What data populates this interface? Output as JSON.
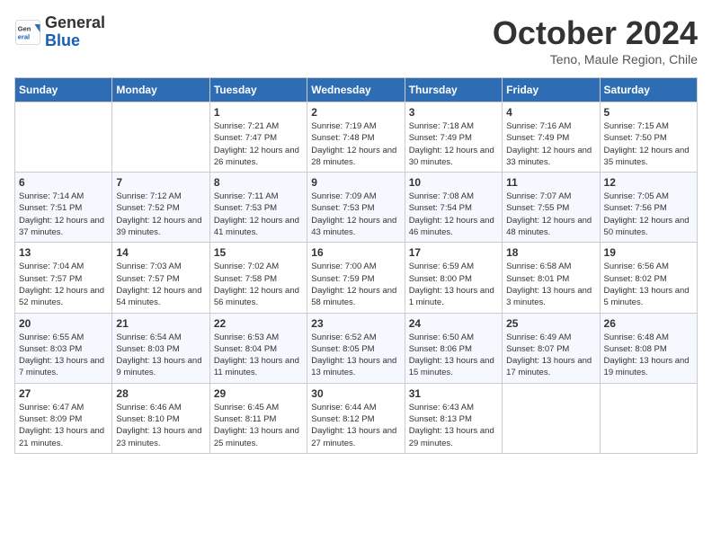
{
  "header": {
    "logo_general": "General",
    "logo_blue": "Blue",
    "month_title": "October 2024",
    "location": "Teno, Maule Region, Chile"
  },
  "days_of_week": [
    "Sunday",
    "Monday",
    "Tuesday",
    "Wednesday",
    "Thursday",
    "Friday",
    "Saturday"
  ],
  "weeks": [
    [
      {
        "day": "",
        "info": ""
      },
      {
        "day": "",
        "info": ""
      },
      {
        "day": "1",
        "info": "Sunrise: 7:21 AM\nSunset: 7:47 PM\nDaylight: 12 hours and 26 minutes."
      },
      {
        "day": "2",
        "info": "Sunrise: 7:19 AM\nSunset: 7:48 PM\nDaylight: 12 hours and 28 minutes."
      },
      {
        "day": "3",
        "info": "Sunrise: 7:18 AM\nSunset: 7:49 PM\nDaylight: 12 hours and 30 minutes."
      },
      {
        "day": "4",
        "info": "Sunrise: 7:16 AM\nSunset: 7:49 PM\nDaylight: 12 hours and 33 minutes."
      },
      {
        "day": "5",
        "info": "Sunrise: 7:15 AM\nSunset: 7:50 PM\nDaylight: 12 hours and 35 minutes."
      }
    ],
    [
      {
        "day": "6",
        "info": "Sunrise: 7:14 AM\nSunset: 7:51 PM\nDaylight: 12 hours and 37 minutes."
      },
      {
        "day": "7",
        "info": "Sunrise: 7:12 AM\nSunset: 7:52 PM\nDaylight: 12 hours and 39 minutes."
      },
      {
        "day": "8",
        "info": "Sunrise: 7:11 AM\nSunset: 7:53 PM\nDaylight: 12 hours and 41 minutes."
      },
      {
        "day": "9",
        "info": "Sunrise: 7:09 AM\nSunset: 7:53 PM\nDaylight: 12 hours and 43 minutes."
      },
      {
        "day": "10",
        "info": "Sunrise: 7:08 AM\nSunset: 7:54 PM\nDaylight: 12 hours and 46 minutes."
      },
      {
        "day": "11",
        "info": "Sunrise: 7:07 AM\nSunset: 7:55 PM\nDaylight: 12 hours and 48 minutes."
      },
      {
        "day": "12",
        "info": "Sunrise: 7:05 AM\nSunset: 7:56 PM\nDaylight: 12 hours and 50 minutes."
      }
    ],
    [
      {
        "day": "13",
        "info": "Sunrise: 7:04 AM\nSunset: 7:57 PM\nDaylight: 12 hours and 52 minutes."
      },
      {
        "day": "14",
        "info": "Sunrise: 7:03 AM\nSunset: 7:57 PM\nDaylight: 12 hours and 54 minutes."
      },
      {
        "day": "15",
        "info": "Sunrise: 7:02 AM\nSunset: 7:58 PM\nDaylight: 12 hours and 56 minutes."
      },
      {
        "day": "16",
        "info": "Sunrise: 7:00 AM\nSunset: 7:59 PM\nDaylight: 12 hours and 58 minutes."
      },
      {
        "day": "17",
        "info": "Sunrise: 6:59 AM\nSunset: 8:00 PM\nDaylight: 13 hours and 1 minute."
      },
      {
        "day": "18",
        "info": "Sunrise: 6:58 AM\nSunset: 8:01 PM\nDaylight: 13 hours and 3 minutes."
      },
      {
        "day": "19",
        "info": "Sunrise: 6:56 AM\nSunset: 8:02 PM\nDaylight: 13 hours and 5 minutes."
      }
    ],
    [
      {
        "day": "20",
        "info": "Sunrise: 6:55 AM\nSunset: 8:03 PM\nDaylight: 13 hours and 7 minutes."
      },
      {
        "day": "21",
        "info": "Sunrise: 6:54 AM\nSunset: 8:03 PM\nDaylight: 13 hours and 9 minutes."
      },
      {
        "day": "22",
        "info": "Sunrise: 6:53 AM\nSunset: 8:04 PM\nDaylight: 13 hours and 11 minutes."
      },
      {
        "day": "23",
        "info": "Sunrise: 6:52 AM\nSunset: 8:05 PM\nDaylight: 13 hours and 13 minutes."
      },
      {
        "day": "24",
        "info": "Sunrise: 6:50 AM\nSunset: 8:06 PM\nDaylight: 13 hours and 15 minutes."
      },
      {
        "day": "25",
        "info": "Sunrise: 6:49 AM\nSunset: 8:07 PM\nDaylight: 13 hours and 17 minutes."
      },
      {
        "day": "26",
        "info": "Sunrise: 6:48 AM\nSunset: 8:08 PM\nDaylight: 13 hours and 19 minutes."
      }
    ],
    [
      {
        "day": "27",
        "info": "Sunrise: 6:47 AM\nSunset: 8:09 PM\nDaylight: 13 hours and 21 minutes."
      },
      {
        "day": "28",
        "info": "Sunrise: 6:46 AM\nSunset: 8:10 PM\nDaylight: 13 hours and 23 minutes."
      },
      {
        "day": "29",
        "info": "Sunrise: 6:45 AM\nSunset: 8:11 PM\nDaylight: 13 hours and 25 minutes."
      },
      {
        "day": "30",
        "info": "Sunrise: 6:44 AM\nSunset: 8:12 PM\nDaylight: 13 hours and 27 minutes."
      },
      {
        "day": "31",
        "info": "Sunrise: 6:43 AM\nSunset: 8:13 PM\nDaylight: 13 hours and 29 minutes."
      },
      {
        "day": "",
        "info": ""
      },
      {
        "day": "",
        "info": ""
      }
    ]
  ]
}
